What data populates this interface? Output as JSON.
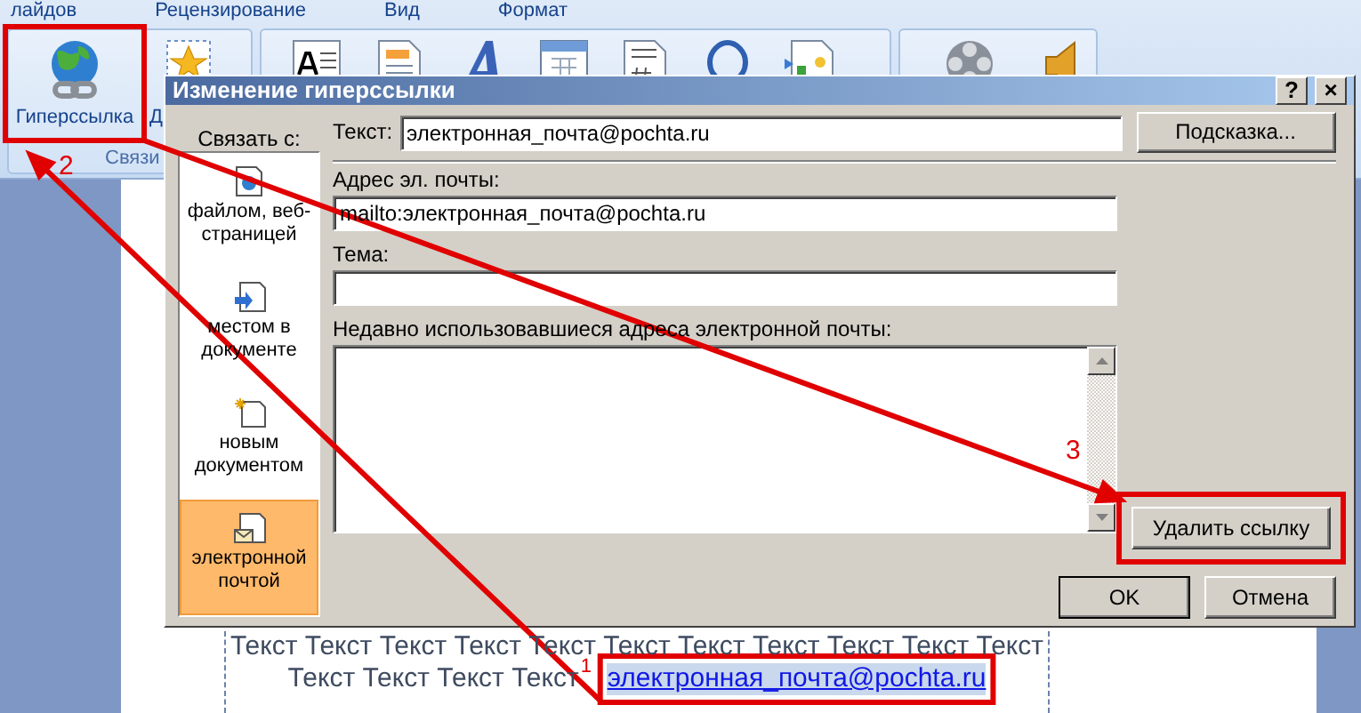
{
  "ribbon": {
    "tabs": [
      {
        "label": "лайдов"
      },
      {
        "label": "Рецензирование"
      },
      {
        "label": "Вид"
      },
      {
        "label": "Формат"
      }
    ],
    "hyperlink_button": {
      "label": "Гиперссылка"
    },
    "next_button": {
      "label": "Д"
    },
    "group_label": "Связи"
  },
  "dialog": {
    "title": "Изменение гиперссылки",
    "help_button": "?",
    "close_button": "×",
    "link_to_label": "Связать с:",
    "link_types": [
      {
        "kind": "file",
        "label": "файлом, веб-страницей",
        "selected": false
      },
      {
        "kind": "place",
        "label": "местом в документе",
        "selected": false
      },
      {
        "kind": "new",
        "label": "новым документом",
        "selected": false
      },
      {
        "kind": "email",
        "label": "электронной почтой",
        "selected": true
      }
    ],
    "text_label": "Текст:",
    "text_value": "электронная_почта@pochta.ru",
    "tip_button": "Подсказка...",
    "address_label": "Адрес эл. почты:",
    "address_value": "mailto:электронная_почта@pochta.ru",
    "subject_label": "Тема:",
    "recent_label": "Недавно использовавшиеся адреса электронной почты:",
    "remove_button": "Удалить ссылку",
    "ok_button": "OK",
    "cancel_button": "Отмена"
  },
  "document": {
    "line_1": "Текст Текст Текст Текст Текст Текст Текст Текст Текст Текст Текст",
    "line_2_text": "Текст Текст Текст Текст",
    "link": "электронная_почта@pochta.ru"
  },
  "annotations": [
    {
      "number": "1"
    },
    {
      "number": "2"
    },
    {
      "number": "3"
    }
  ]
}
